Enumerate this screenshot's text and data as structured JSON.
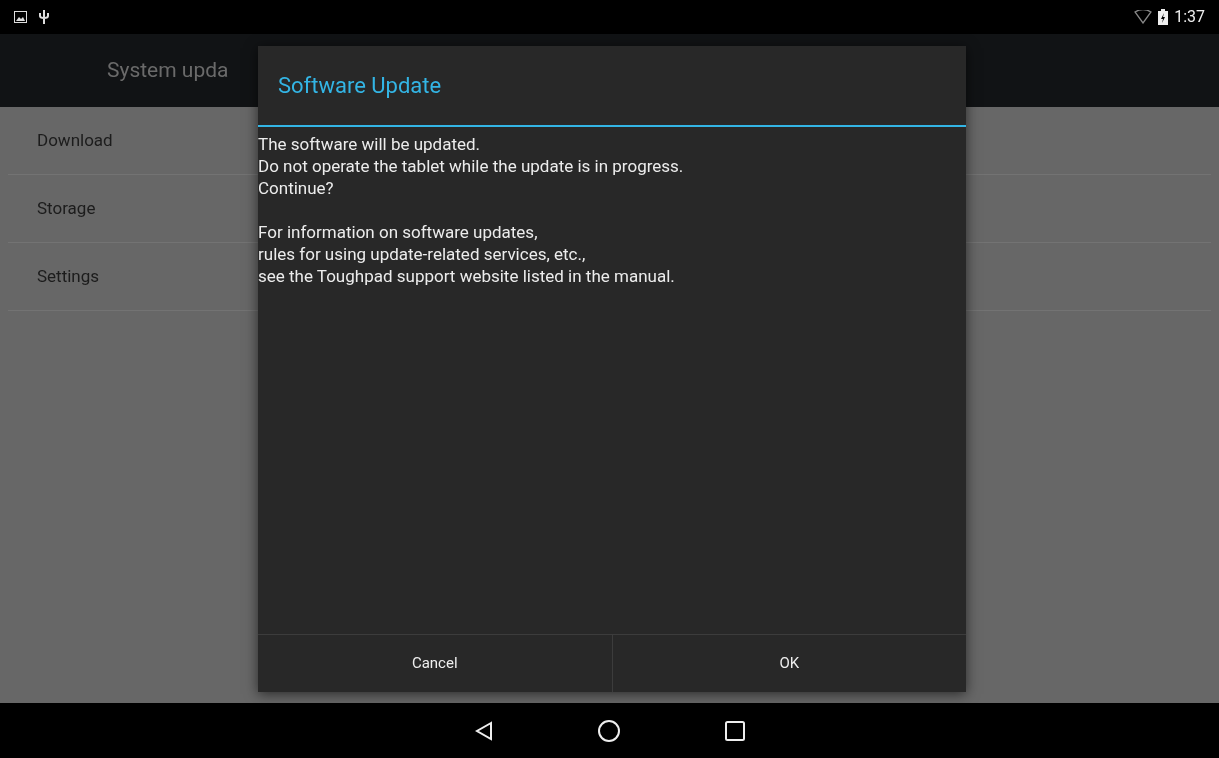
{
  "status_bar": {
    "time": "1:37"
  },
  "action_bar": {
    "title": "System upda"
  },
  "list": [
    {
      "label": "Download"
    },
    {
      "label": "Storage"
    },
    {
      "label": "Settings"
    }
  ],
  "dialog": {
    "title": "Software Update",
    "paragraphs": [
      "The software will be updated.\nDo not operate the tablet while the update is in progress.\nContinue?",
      "For information on software updates,\nrules for using update-related services, etc.,\nsee the Toughpad support website listed in the manual."
    ],
    "buttons": [
      "Cancel",
      "OK"
    ]
  }
}
